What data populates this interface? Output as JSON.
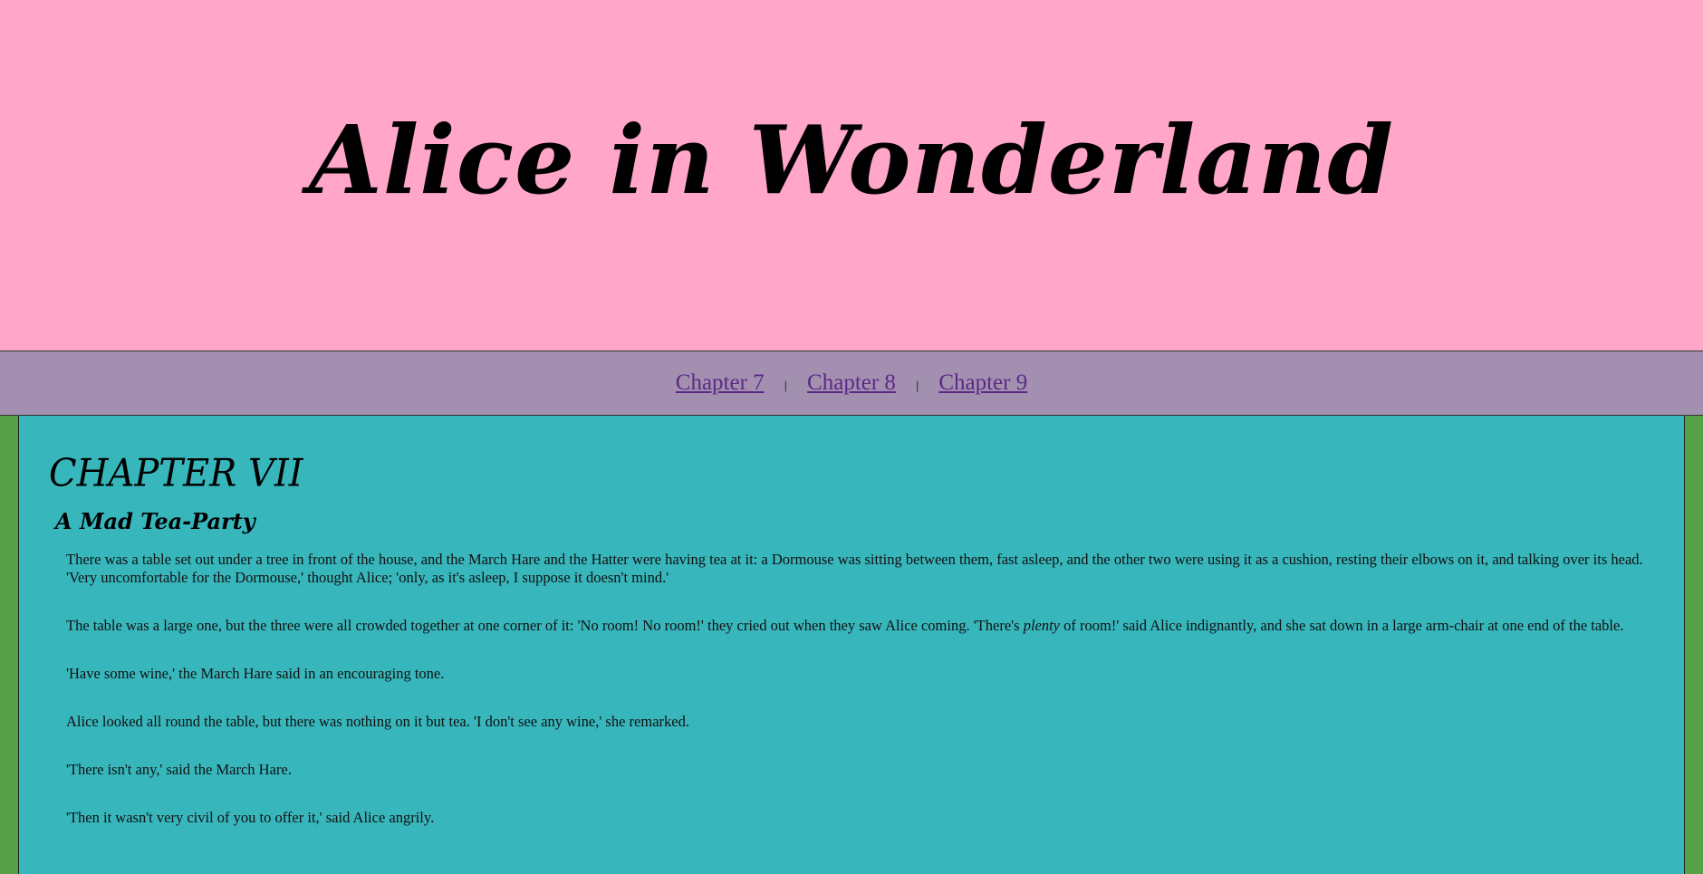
{
  "header": {
    "title": "Alice in Wonderland"
  },
  "nav": {
    "links": [
      "Chapter 7",
      "Chapter 8",
      "Chapter 9"
    ],
    "separator": "|"
  },
  "chapter": {
    "number": "CHAPTER VII",
    "title": "A Mad Tea-Party",
    "paragraphs": [
      "There was a table set out under a tree in front of the house, and the March Hare and the Hatter were having tea at it: a Dormouse was sitting between them, fast asleep, and the other two were using it as a cushion, resting their elbows on it, and talking over its head. 'Very uncomfortable for the Dormouse,' thought Alice; 'only, as it's asleep, I suppose it doesn't mind.'",
      {
        "before": "The table was a large one, but the three were all crowded together at one corner of it: 'No room! No room!' they cried out when they saw Alice coming. 'There's ",
        "emphasis": "plenty",
        "after": " of room!' said Alice indignantly, and she sat down in a large arm-chair at one end of the table."
      },
      "'Have some wine,' the March Hare said in an encouraging tone.",
      "Alice looked all round the table, but there was nothing on it but tea. 'I don't see any wine,' she remarked.",
      "'There isn't any,' said the March Hare.",
      "'Then it wasn't very civil of you to offer it,' said Alice angrily."
    ]
  },
  "colors": {
    "banner": "#ffa6c9",
    "nav": "#a390b1",
    "content": "#37b6bc",
    "side": "#56a047",
    "link": "#5b2a86"
  }
}
